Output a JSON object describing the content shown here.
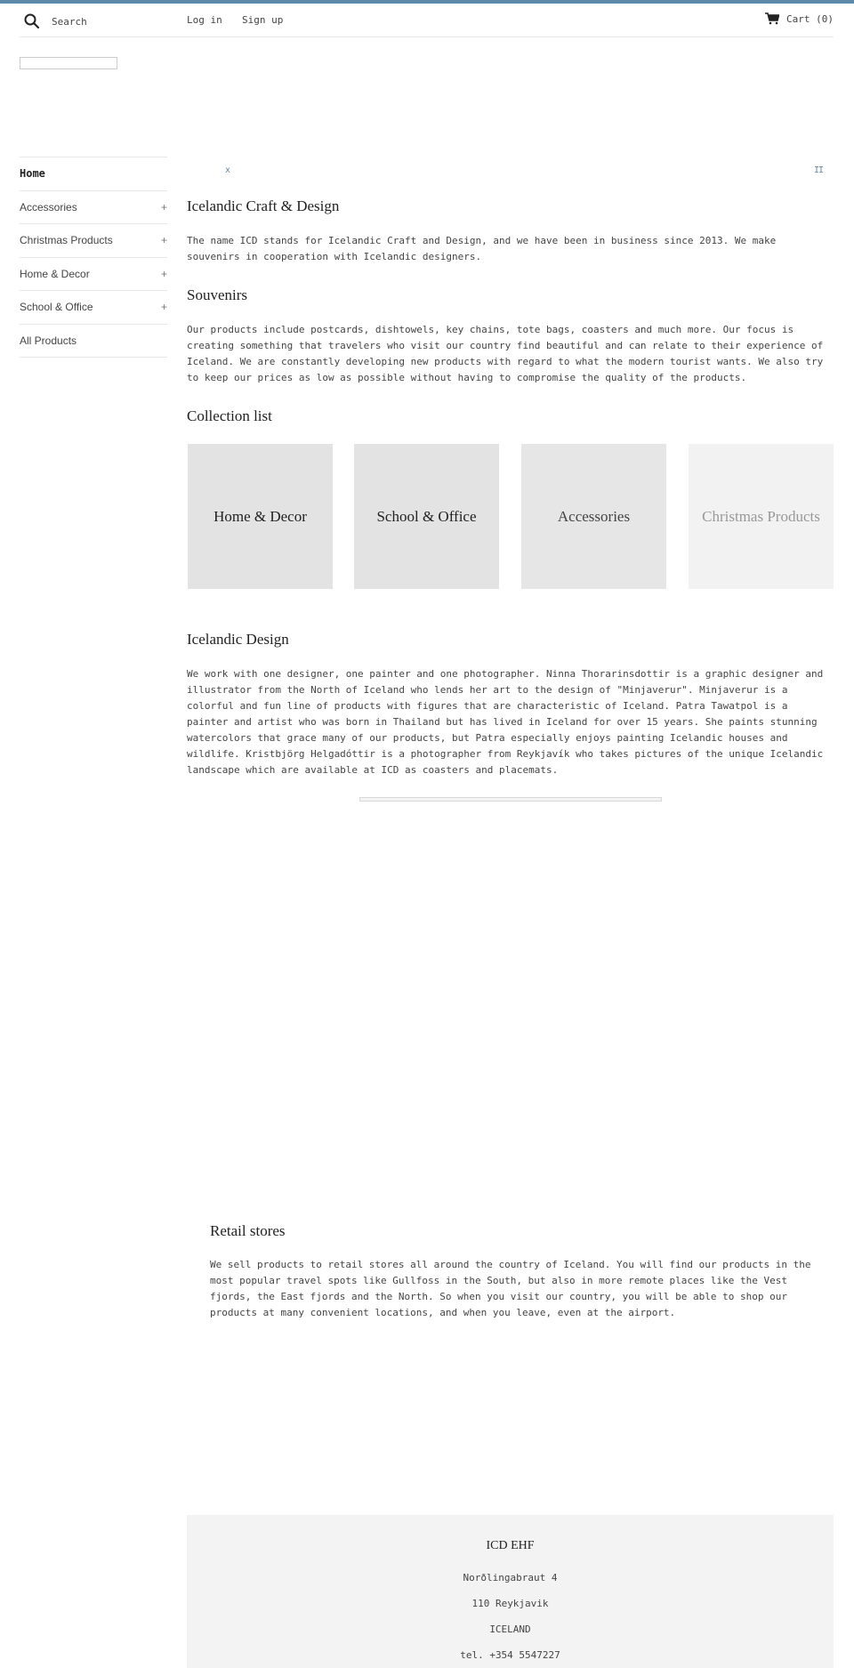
{
  "colors": {
    "accent_bar": "#5c8aa8",
    "tile_bg": [
      "#e3e3e3",
      "#e3e3e3",
      "#e6e6e6",
      "#f2f2f2"
    ],
    "tile_text": [
      "#222222",
      "#222222",
      "#444444",
      "#999999"
    ]
  },
  "header": {
    "search_placeholder": "Search",
    "login_label": "Log in",
    "signup_label": "Sign up",
    "cart_label": "Cart (0)"
  },
  "sidebar": {
    "items": [
      {
        "label": "Home",
        "expandable": false,
        "active": true
      },
      {
        "label": "Accessories",
        "expandable": true,
        "toggle": "+"
      },
      {
        "label": "Christmas Products",
        "expandable": true,
        "toggle": "+"
      },
      {
        "label": "Home & Decor",
        "expandable": true,
        "toggle": "+"
      },
      {
        "label": "School & Office",
        "expandable": true,
        "toggle": "+"
      },
      {
        "label": "All Products",
        "expandable": false
      }
    ]
  },
  "slideshow": {
    "prev_glyph": "x",
    "pause_glyph": "II"
  },
  "sections": {
    "intro": {
      "title": "Icelandic Craft & Design",
      "text": "The name ICD stands for Icelandic Craft and Design, and we have been in business since 2013. We make souvenirs in cooperation with Icelandic designers."
    },
    "souvenirs": {
      "title": "Souvenirs",
      "text": "Our products include postcards, dishtowels, key chains, tote bags, coasters and much more. Our focus is creating something that travelers who visit our country find beautiful and can relate to their experience of Iceland. We are constantly developing new products with regard to what the modern tourist wants. We also try to keep our prices as low as possible without having to compromise the quality of the products."
    },
    "collection_list": {
      "title": "Collection list",
      "items": [
        "Home & Decor",
        "School & Office",
        "Accessories",
        "Christmas Products"
      ]
    },
    "design": {
      "title": "Icelandic Design",
      "text": "We work with one designer, one painter and one photographer. Ninna Thorarinsdottir is a graphic designer and illustrator from the North of Iceland who lends her art to the design of \"Minjaverur\". Minjaverur is a colorful and fun line of products with figures that are characteristic of Iceland. Patra Tawatpol is a painter and artist who was born in Thailand but has lived in Iceland for over 15 years. She paints stunning watercolors that grace many of our products, but Patra especially enjoys painting Icelandic houses and wildlife. Kristbjörg Helgadóttir is a photographer from Reykjavík who takes pictures of the unique Icelandic landscape which are available at ICD as coasters and placemats."
    },
    "retail": {
      "title": "Retail stores",
      "text": "We sell products to retail stores all around the country of Iceland.  You will find our products in the most popular travel spots like Gullfoss in the South, but also in more remote places like the Vest fjords, the East fjords and the North.  So when you visit our country, you will be able to shop our products at many convenient locations, and when you leave, even at the airport."
    }
  },
  "loading_progress": 0,
  "footer": {
    "company": "ICD EHF",
    "lines": [
      "Norðlingabraut 4",
      "110 Reykjavik",
      "ICELAND",
      "tel. +354 5547227"
    ]
  }
}
